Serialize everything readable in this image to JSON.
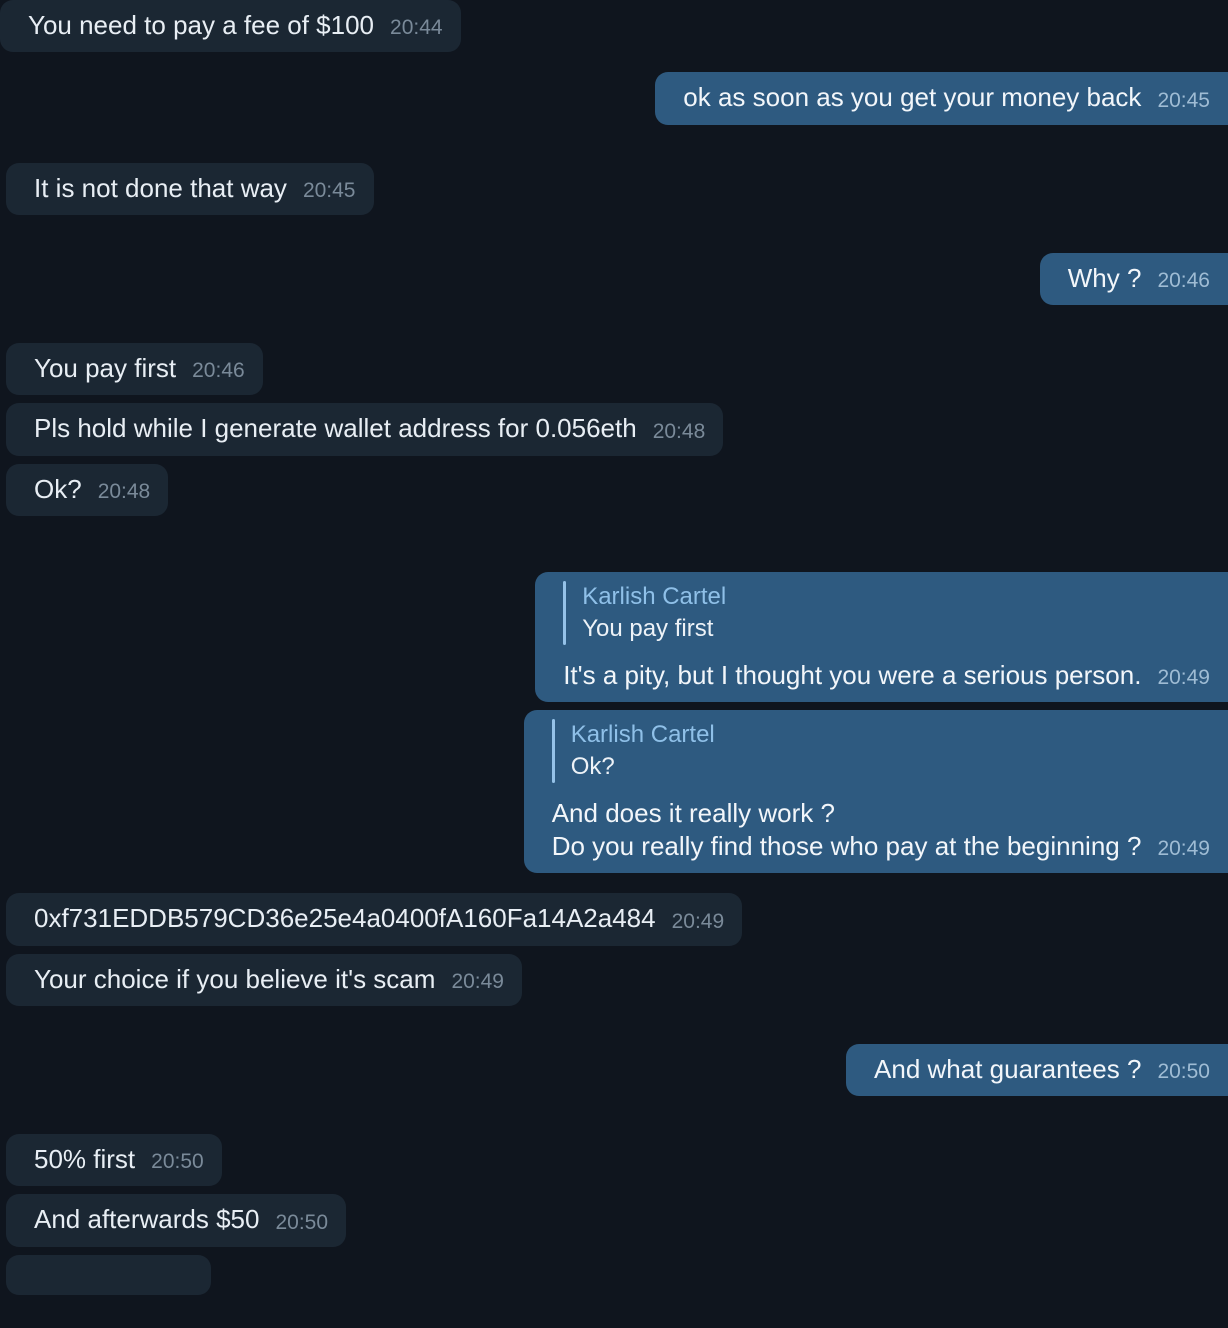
{
  "conversation": {
    "peer_name": "Karlish Cartel",
    "theme": {
      "background": "#0f151e",
      "incoming_bubble": "#1b2733",
      "outgoing_bubble": "#2e5a80",
      "incoming_text": "#e8eef4",
      "outgoing_text": "#f2f6fa",
      "incoming_time": "#7a8a99",
      "outgoing_time": "#9fbcd4",
      "quote_bar": "#95c2e8",
      "quote_author": "#8fc0e8"
    },
    "messages": [
      {
        "id": "m1",
        "direction": "in",
        "text": "You need to pay a fee of $100",
        "time": "20:44"
      },
      {
        "id": "m2",
        "direction": "out",
        "text": "ok as soon as you get your money back",
        "time": "20:45"
      },
      {
        "id": "m3",
        "direction": "in",
        "text": "It is not done that way",
        "time": "20:45"
      },
      {
        "id": "m4",
        "direction": "out",
        "text": "Why ?",
        "time": "20:46"
      },
      {
        "id": "m5",
        "direction": "in",
        "text": "You pay first",
        "time": "20:46"
      },
      {
        "id": "m6",
        "direction": "in",
        "text": "Pls hold while I generate wallet address for 0.056eth",
        "time": "20:48"
      },
      {
        "id": "m7",
        "direction": "in",
        "text": "Ok?",
        "time": "20:48"
      },
      {
        "id": "m8",
        "direction": "out",
        "quote_author": "Karlish Cartel",
        "quote_text": "You pay first",
        "text": "It's a pity, but I thought you were a serious person.",
        "time": "20:49"
      },
      {
        "id": "m9",
        "direction": "out",
        "quote_author": "Karlish Cartel",
        "quote_text": "Ok?",
        "text": "And does it really work ?\nDo you really find those who pay at the beginning ?",
        "time": "20:49"
      },
      {
        "id": "m10",
        "direction": "in",
        "text": "0xf731EDDB579CD36e25e4a0400fA160Fa14A2a484",
        "time": "20:49"
      },
      {
        "id": "m11",
        "direction": "in",
        "text": "Your choice if you believe it's scam",
        "time": "20:49"
      },
      {
        "id": "m12",
        "direction": "out",
        "text": "And what guarantees ?",
        "time": "20:50"
      },
      {
        "id": "m13",
        "direction": "in",
        "text": "50% first",
        "time": "20:50"
      },
      {
        "id": "m14",
        "direction": "in",
        "text": "And afterwards $50",
        "time": "20:50"
      }
    ]
  }
}
